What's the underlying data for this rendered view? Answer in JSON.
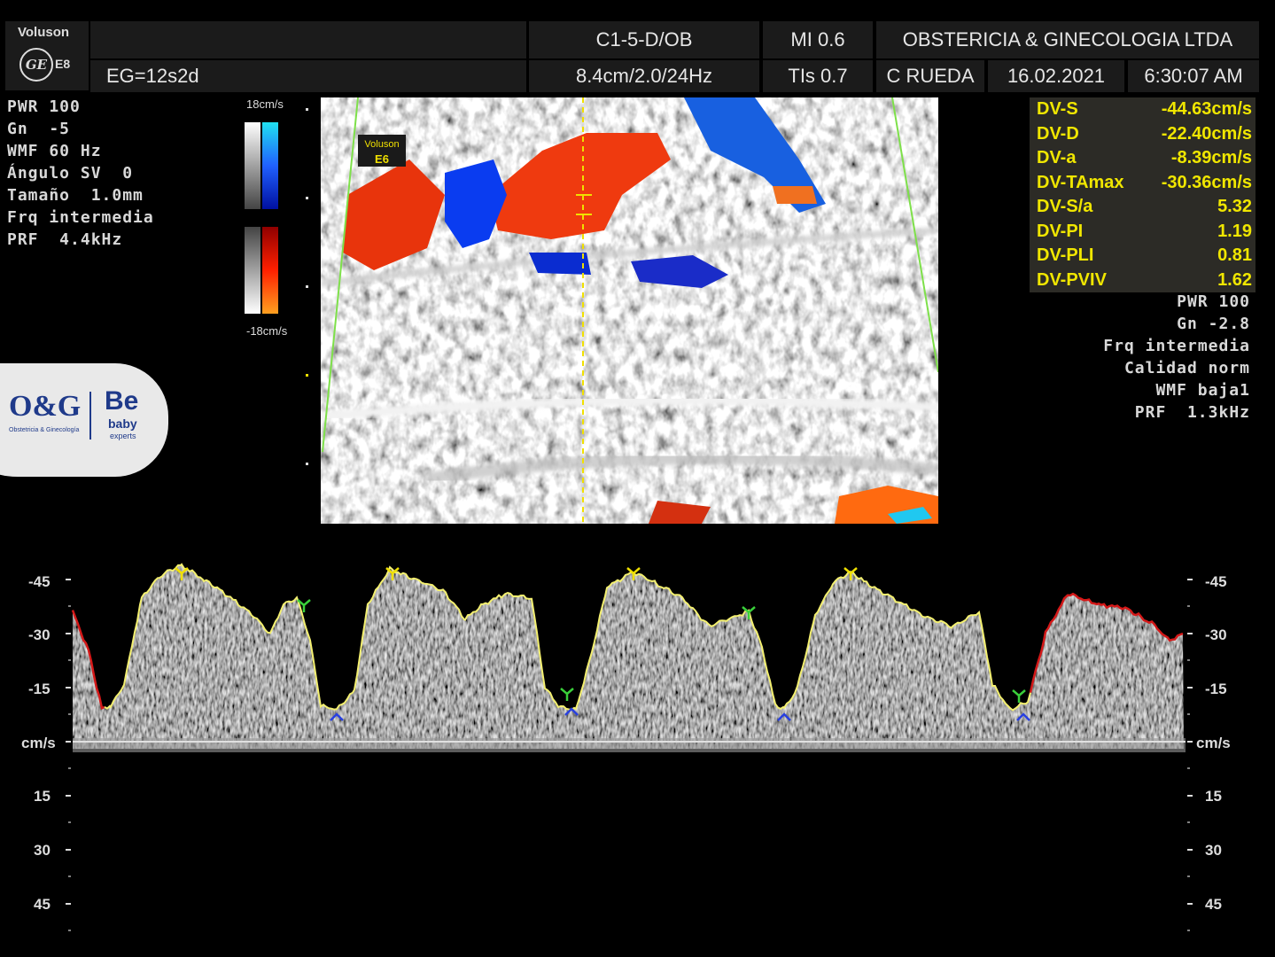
{
  "header": {
    "brand": "Voluson",
    "brand_model": "E8",
    "brand_logo": "ge-monogram-icon",
    "eg": "EG=12s2d",
    "probe": "C1-5-D/OB",
    "depth_info": "8.4cm/2.0/24Hz",
    "mi": "MI  0.6",
    "tis": "TIs  0.7",
    "clinic": "OBSTERICIA & GINECOLOGIA LTDA",
    "operator": "C RUEDA",
    "date": "16.02.2021",
    "time": "6:30:07 AM"
  },
  "left_params": [
    "PWR 100",
    "Gn  -5",
    "WMF 60 Hz",
    "Ángulo SV  0",
    "Tamaño  1.0mm",
    "Frq intermedia",
    "PRF  4.4kHz"
  ],
  "color_scale": {
    "top": "18cm/s",
    "bottom": "-18cm/s"
  },
  "image_tag": {
    "line1": "Voluson",
    "line2": "E6"
  },
  "measurements": [
    {
      "label": "DV-S",
      "value": "-44.63cm/s"
    },
    {
      "label": "DV-D",
      "value": "-22.40cm/s"
    },
    {
      "label": "DV-a",
      "value": "-8.39cm/s"
    },
    {
      "label": "DV-TAmax",
      "value": "-30.36cm/s"
    },
    {
      "label": "DV-S/a",
      "value": "5.32"
    },
    {
      "label": "DV-PI",
      "value": "1.19"
    },
    {
      "label": "DV-PLI",
      "value": "0.81"
    },
    {
      "label": "DV-PVIV",
      "value": "1.62"
    }
  ],
  "right_params": [
    "PWR 100",
    "Gn -2.8",
    "Frq intermedia",
    "Calidad norm",
    "WMF baja1",
    "PRF  1.3kHz"
  ],
  "logo": {
    "left_text": "O&G",
    "left_sub": "Obstetricia & Ginecología",
    "right_text": "Be",
    "right_sub1": "baby",
    "right_sub2": "experts"
  },
  "doppler_axis": {
    "labels_top": [
      "-45",
      "-30",
      "-15"
    ],
    "unit": "cm/s",
    "labels_bottom": [
      "15",
      "30",
      "45"
    ]
  },
  "colors": {
    "trace": "#f4f070",
    "trace_edge": "#d41818",
    "meas_text": "#f0e600",
    "sample_line": "#f0e000",
    "sector_line": "#7ee04a"
  }
}
